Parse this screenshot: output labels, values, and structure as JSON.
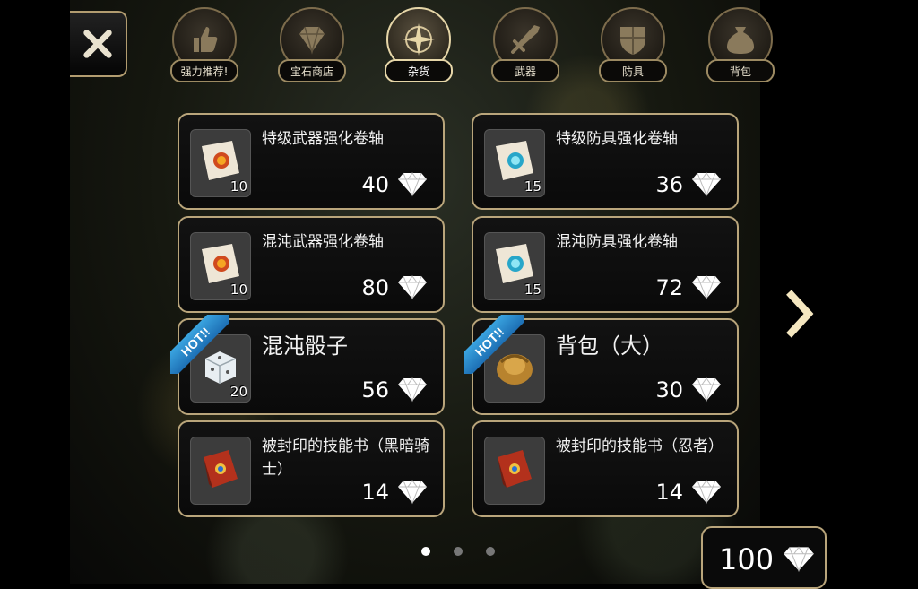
{
  "tabs": [
    {
      "label": "强力推荐!",
      "icon": "thumbs-up-icon"
    },
    {
      "label": "宝石商店",
      "icon": "gem-icon"
    },
    {
      "label": "杂货",
      "icon": "compass-icon",
      "active": true
    },
    {
      "label": "武器",
      "icon": "sword-icon"
    },
    {
      "label": "防具",
      "icon": "shield-icon"
    },
    {
      "label": "背包",
      "icon": "bag-icon"
    }
  ],
  "items": [
    {
      "name": "特级武器强化卷轴",
      "qty": "10",
      "price": "40",
      "icon": "red-scroll-icon",
      "hot": false
    },
    {
      "name": "特级防具强化卷轴",
      "qty": "15",
      "price": "36",
      "icon": "blue-scroll-icon",
      "hot": false
    },
    {
      "name": "混沌武器强化卷轴",
      "qty": "10",
      "price": "80",
      "icon": "red-scroll-icon",
      "hot": false
    },
    {
      "name": "混沌防具强化卷轴",
      "qty": "15",
      "price": "72",
      "icon": "blue-scroll-icon",
      "hot": false
    },
    {
      "name": "混沌骰子",
      "qty": "20",
      "price": "56",
      "icon": "dice-icon",
      "hot": true
    },
    {
      "name": "背包（大）",
      "qty": "",
      "price": "30",
      "icon": "backpack-icon",
      "hot": true
    },
    {
      "name": "被封印的技能书（黑暗骑士）",
      "qty": "",
      "price": "14",
      "icon": "skill-book-icon",
      "hot": false
    },
    {
      "name": "被封印的技能书（忍者）",
      "qty": "",
      "price": "14",
      "icon": "skill-book-icon",
      "hot": false
    }
  ],
  "hot_label": "HOT!!",
  "pagination": {
    "pages": 3,
    "current": 1
  },
  "currency": {
    "amount": "100",
    "icon": "diamond-icon"
  },
  "colors": {
    "frame": "#b9a57b",
    "hot_ribbon": "#2b8fd0"
  }
}
